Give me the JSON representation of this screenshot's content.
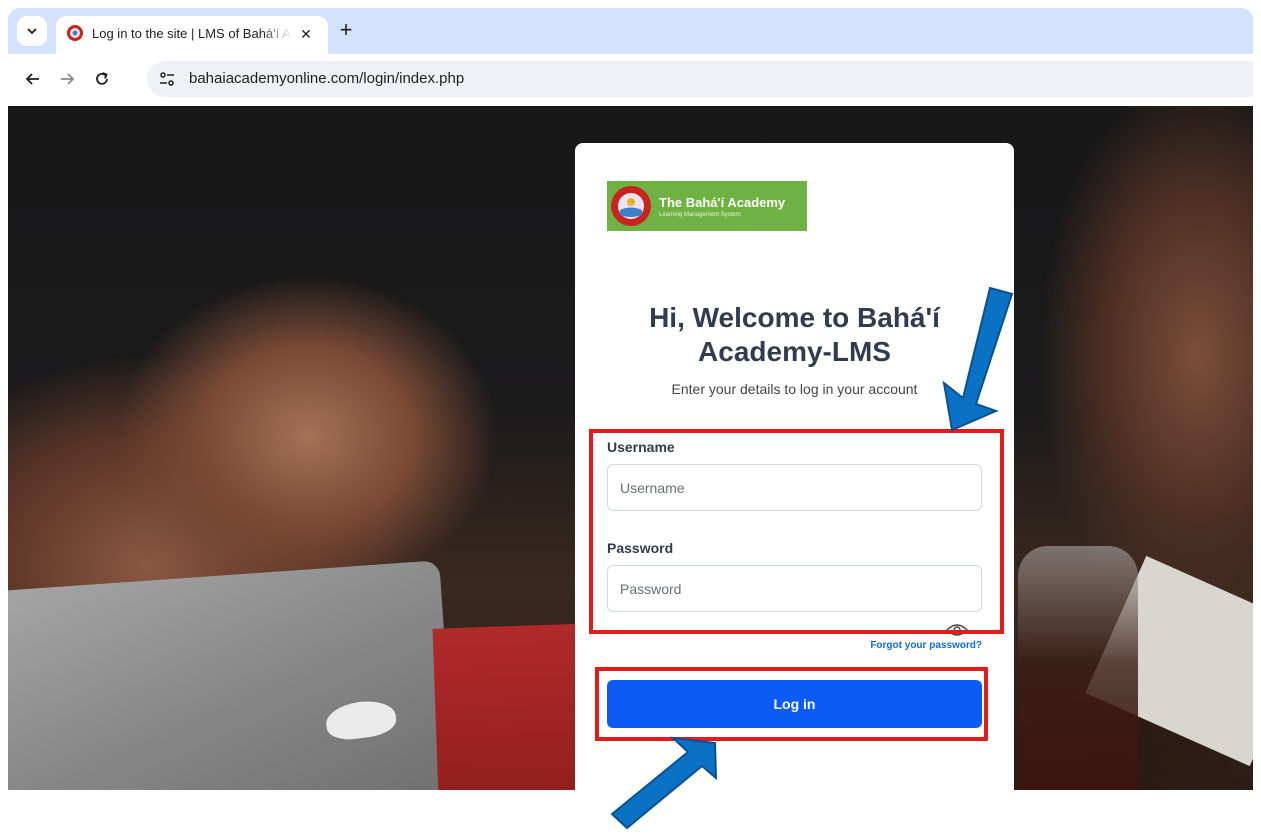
{
  "browser": {
    "tab": {
      "title": "Log in to the site | LMS of Bahá'í Academy",
      "close_glyph": "✕"
    },
    "new_tab_glyph": "+",
    "url": "bahaiacademyonline.com/login/index.php"
  },
  "page": {
    "logo": {
      "name": "The Bahá'í Academy",
      "subtitle": "Learning Management System"
    },
    "heading": "Hi, Welcome to Bahá'í Academy-LMS",
    "subheading": "Enter your details to log in your account",
    "username": {
      "label": "Username",
      "placeholder": "Username",
      "value": ""
    },
    "password": {
      "label": "Password",
      "placeholder": "Password",
      "value": ""
    },
    "forgot_link": "Forgot your password?",
    "login_button": "Log in"
  },
  "colors": {
    "accent": "#0b5cf5",
    "highlight": "#e21b1b",
    "annotation_arrow": "#0a72c4",
    "logo_bg": "#6fb243"
  }
}
